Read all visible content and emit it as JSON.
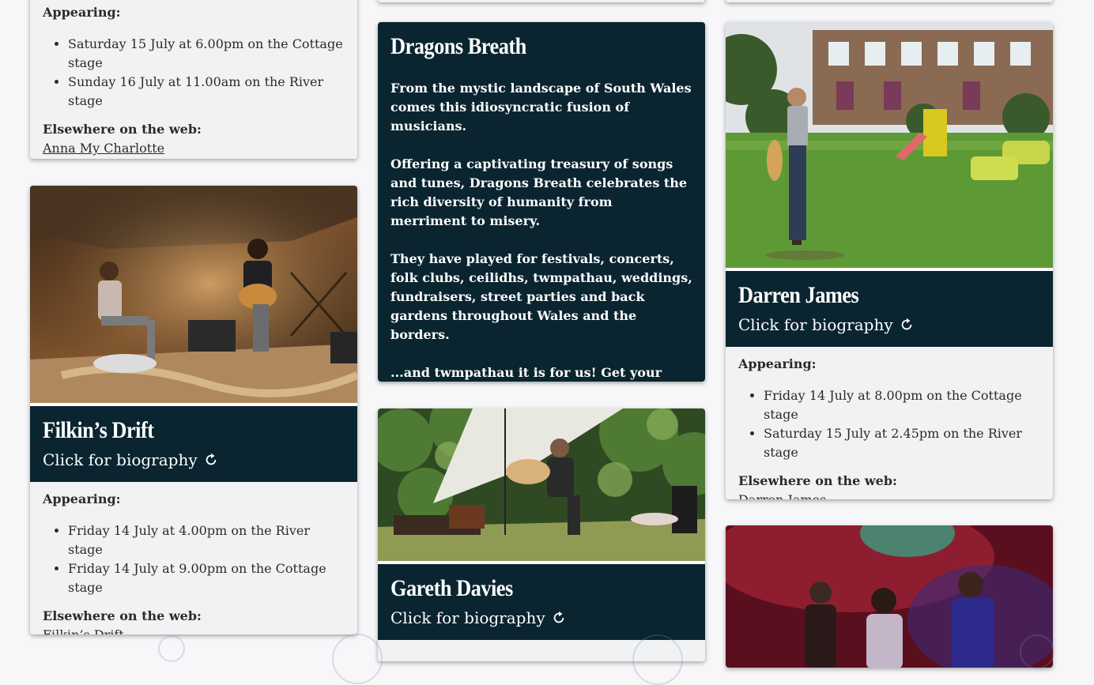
{
  "cards": {
    "anna": {
      "appearing_label": "Appearing:",
      "gigs": [
        "Saturday 15 July at 6.00pm on the Cottage stage",
        "Sunday 16 July at 11.00am on the River stage"
      ],
      "web_label": "Elsewhere on the web:",
      "link": "Anna My Charlotte"
    },
    "filkins": {
      "name": "Filkin’s Drift",
      "bio": "Click for biography",
      "appearing_label": "Appearing:",
      "gigs": [
        "Friday 14 July at 4.00pm on the River stage",
        "Friday 14 July at 9.00pm on the Cottage stage"
      ],
      "web_label": "Elsewhere on the web:",
      "link": "Filkin’s Drift"
    },
    "dragons": {
      "name": "Dragons Breath",
      "paragraphs": [
        "From the mystic landscape of South Wales comes this idiosyncratic fusion of musicians.",
        "Offering a captivating treasury of songs and tunes, Dragons Breath celebrates the rich diversity of humanity from merriment to misery.",
        "They have played for festivals, concerts, folk clubs, ceilidhs, twmpathau, weddings, fundraisers, street parties and back gardens throughout Wales and the borders.",
        "...and twmpathau it is for us! Get your dancing shoes/clogs on for Sunday afternoon at FotL!"
      ]
    },
    "gareth": {
      "name": "Gareth Davies",
      "bio": "Click for biography"
    },
    "darren": {
      "name": "Darren James",
      "bio": "Click for biography",
      "appearing_label": "Appearing:",
      "gigs": [
        "Friday 14 July at 8.00pm on the Cottage stage",
        "Saturday 15 July at 2.45pm on the River stage"
      ],
      "web_label": "Elsewhere on the web:",
      "link": "Darren James"
    }
  },
  "colors": {
    "header_bg": "#0a2530",
    "card_bg": "#f1f2f4",
    "page_bg": "#f7f7f9"
  },
  "icons": {
    "bio_toggle": "refresh-icon"
  }
}
